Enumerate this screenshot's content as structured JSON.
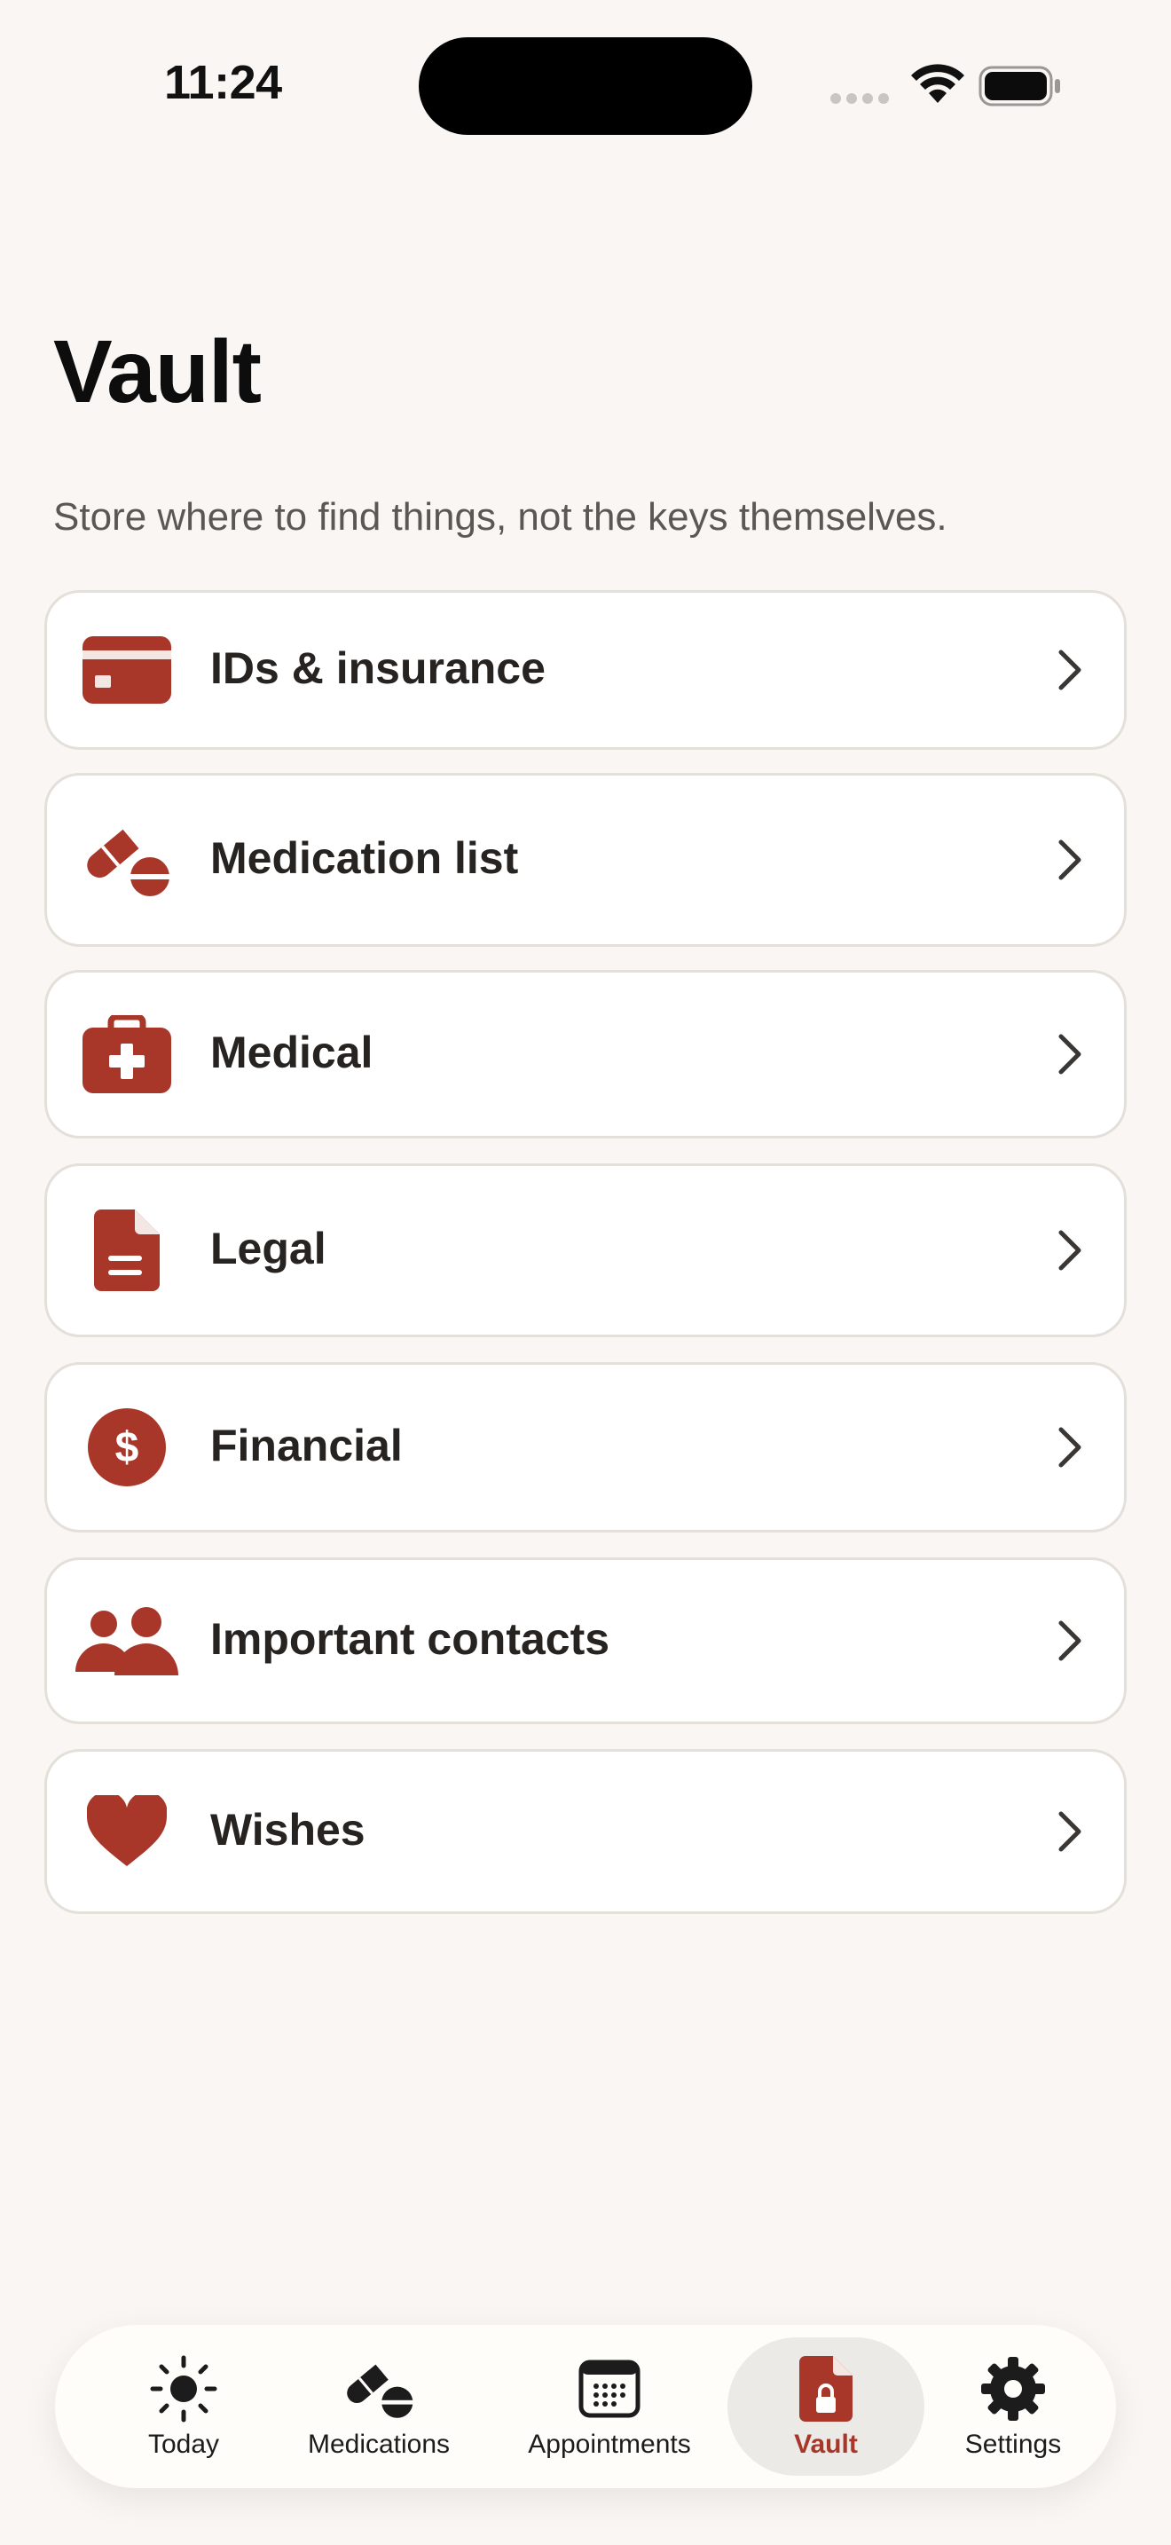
{
  "status_bar": {
    "time": "11:24"
  },
  "header": {
    "title": "Vault",
    "subtitle": "Store where to find things, not the keys themselves."
  },
  "colors": {
    "accent": "#a8372a",
    "background": "#f9f6f3",
    "card": "#ffffff"
  },
  "vault_items": [
    {
      "label": "IDs & insurance",
      "icon": "id-card-icon"
    },
    {
      "label": "Medication list",
      "icon": "pills-icon"
    },
    {
      "label": "Medical",
      "icon": "medical-kit-icon"
    },
    {
      "label": "Legal",
      "icon": "document-icon"
    },
    {
      "label": "Financial",
      "icon": "dollar-icon"
    },
    {
      "label": "Important contacts",
      "icon": "people-icon"
    },
    {
      "label": "Wishes",
      "icon": "heart-icon"
    }
  ],
  "tab_bar": {
    "active": "Vault",
    "tabs": [
      {
        "label": "Today",
        "icon": "sun-icon"
      },
      {
        "label": "Medications",
        "icon": "pills-icon"
      },
      {
        "label": "Appointments",
        "icon": "calendar-icon"
      },
      {
        "label": "Vault",
        "icon": "locked-document-icon"
      },
      {
        "label": "Settings",
        "icon": "gear-icon"
      }
    ]
  }
}
